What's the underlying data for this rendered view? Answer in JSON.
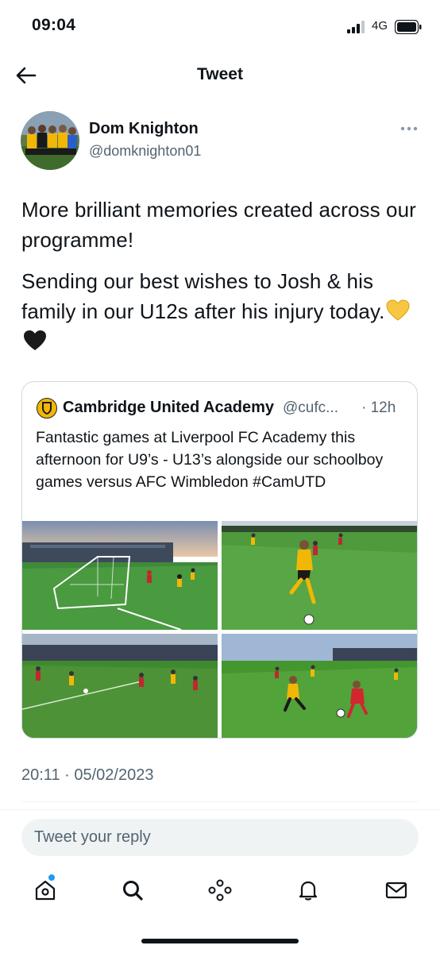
{
  "status_bar": {
    "time": "09:04",
    "network": "4G",
    "icons": [
      "signal-icon",
      "battery-icon"
    ]
  },
  "header": {
    "title": "Tweet",
    "back_icon": "back-arrow-icon"
  },
  "tweet": {
    "author": {
      "name": "Dom Knighton",
      "handle": "@domknighton01"
    },
    "more_icon": "more-options-icon",
    "paragraph_1": "More brilliant memories created across our programme!",
    "paragraph_2": "Sending our best wishes to Josh & his family in our U12s after his injury today.",
    "emojis": [
      "yellow-heart-icon",
      "black-heart-icon"
    ],
    "timestamp": "20:11 · 05/02/2023"
  },
  "quoted_tweet": {
    "author_name": "Cambridge United Academy",
    "author_handle": "@cufc...",
    "time": "· 12h",
    "text": "Fantastic games at Liverpool FC Academy this afternoon for U9’s - U13’s alongside our schoolboy games versus AFC Wimbledon #CamUTD",
    "photos": 4
  },
  "reply": {
    "placeholder": "Tweet your reply"
  },
  "bottom_nav": {
    "items": [
      "home-icon",
      "search-icon",
      "spaces-icon",
      "notifications-icon",
      "messages-icon"
    ]
  },
  "colors": {
    "text": "#0f1419",
    "secondary_text": "#536471",
    "accent": "#1d9bf0",
    "border": "#cfd9de"
  }
}
